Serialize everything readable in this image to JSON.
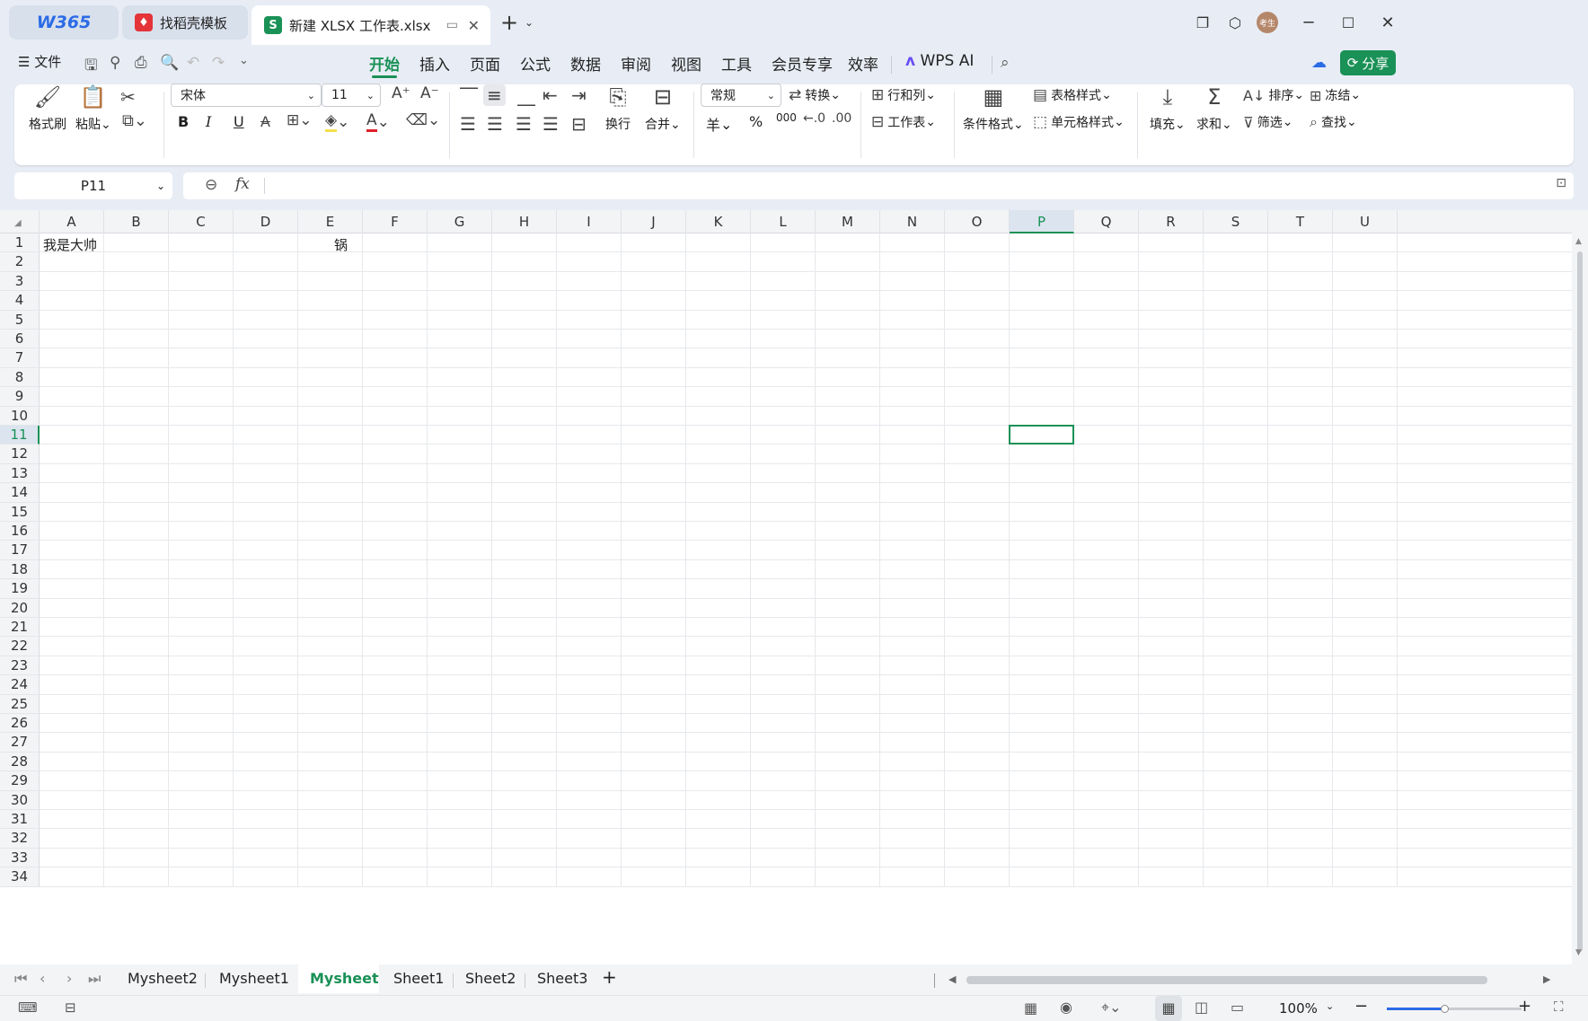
{
  "tabs": [
    {
      "label": "W365"
    },
    {
      "label": "找稻壳模板"
    },
    {
      "label": "新建 XLSX 工作表.xlsx"
    }
  ],
  "user_avatar": "考生",
  "menu": {
    "file": "文件",
    "items": [
      "开始",
      "插入",
      "页面",
      "公式",
      "数据",
      "审阅",
      "视图",
      "工具",
      "会员专享",
      "效率"
    ],
    "wps_ai": "WPS AI",
    "share": "分享"
  },
  "ribbon": {
    "format_painter": "格式刷",
    "paste": "粘贴",
    "font_name": "宋体",
    "font_size": "11",
    "wrap": "换行",
    "merge": "合并",
    "number_format": "常规",
    "convert": "转换",
    "rows_cols": "行和列",
    "worksheet": "工作表",
    "cond_format": "条件格式",
    "table_style": "表格样式",
    "cell_style": "单元格样式",
    "fill": "填充",
    "sum": "求和",
    "sort": "排序",
    "filter": "筛选",
    "freeze": "冻结",
    "find": "查找",
    "bold": "B",
    "italic": "I",
    "underline": "U",
    "currency": "羊",
    "percent": "%",
    "thousands": "000"
  },
  "formula_bar": {
    "cell_ref": "P11",
    "fx": "fx",
    "value": ""
  },
  "columns": [
    "A",
    "B",
    "C",
    "D",
    "E",
    "F",
    "G",
    "H",
    "I",
    "J",
    "K",
    "L",
    "M",
    "N",
    "O",
    "P",
    "Q",
    "R",
    "S",
    "T",
    "U"
  ],
  "rows": [
    "1",
    "2",
    "3",
    "4",
    "5",
    "6",
    "7",
    "8",
    "9",
    "10",
    "11",
    "12",
    "13",
    "14",
    "15",
    "16",
    "17",
    "18",
    "19",
    "20",
    "21",
    "22",
    "23",
    "24",
    "25",
    "26",
    "27",
    "28",
    "29",
    "30",
    "31",
    "32",
    "33",
    "34"
  ],
  "cells": {
    "A1": "我是大帅",
    "E1": "锅"
  },
  "selected_cell": "P11",
  "sheets": [
    "Mysheet2",
    "Mysheet1",
    "Mysheet",
    "Sheet1",
    "Sheet2",
    "Sheet3"
  ],
  "active_sheet": "Mysheet",
  "status": {
    "zoom": "100%"
  },
  "colors": {
    "accent": "#1a9156",
    "ribbon_bg": "#ffffff",
    "chrome_bg": "#e8edf5"
  }
}
